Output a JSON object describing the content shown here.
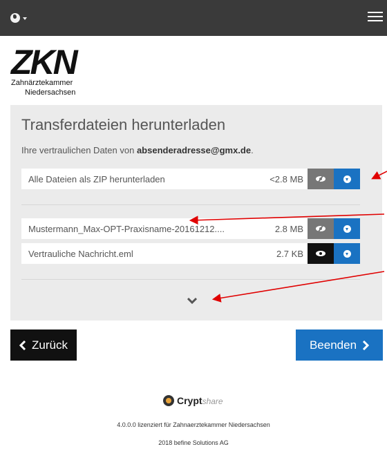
{
  "header": {
    "language_icon": "globe-icon",
    "menu_icon": "hamburger-icon"
  },
  "logo": {
    "mark": "ZKN",
    "line1": "Zahnärztekammer",
    "line2": "Niedersachsen"
  },
  "panel": {
    "title": "Transferdateien herunterladen",
    "info_prefix": "Ihre vertraulichen Daten von ",
    "sender": "absenderadresse@gmx.de",
    "info_suffix": ".",
    "zip_row": {
      "name": "Alle Dateien als ZIP herunterladen",
      "size": "<2.8 MB"
    },
    "files": [
      {
        "name": "Mustermann_Max-OPT-Praxisname-20161212....",
        "size": "2.8 MB"
      },
      {
        "name": "Vertrauliche Nachricht.eml",
        "size": "2.7 KB"
      }
    ]
  },
  "actions": {
    "back_label": "Zurück",
    "end_label": "Beenden"
  },
  "footer": {
    "brand": "Crypt",
    "brand_suffix": "share",
    "license": "4.0.0.0 lizenziert für Zahnaerztekammer Niedersachsen",
    "copyright": "2018 befine Solutions AG"
  },
  "colors": {
    "topbar": "#3a3a3a",
    "accent": "#1a72c2",
    "annotation": "#e00000"
  }
}
